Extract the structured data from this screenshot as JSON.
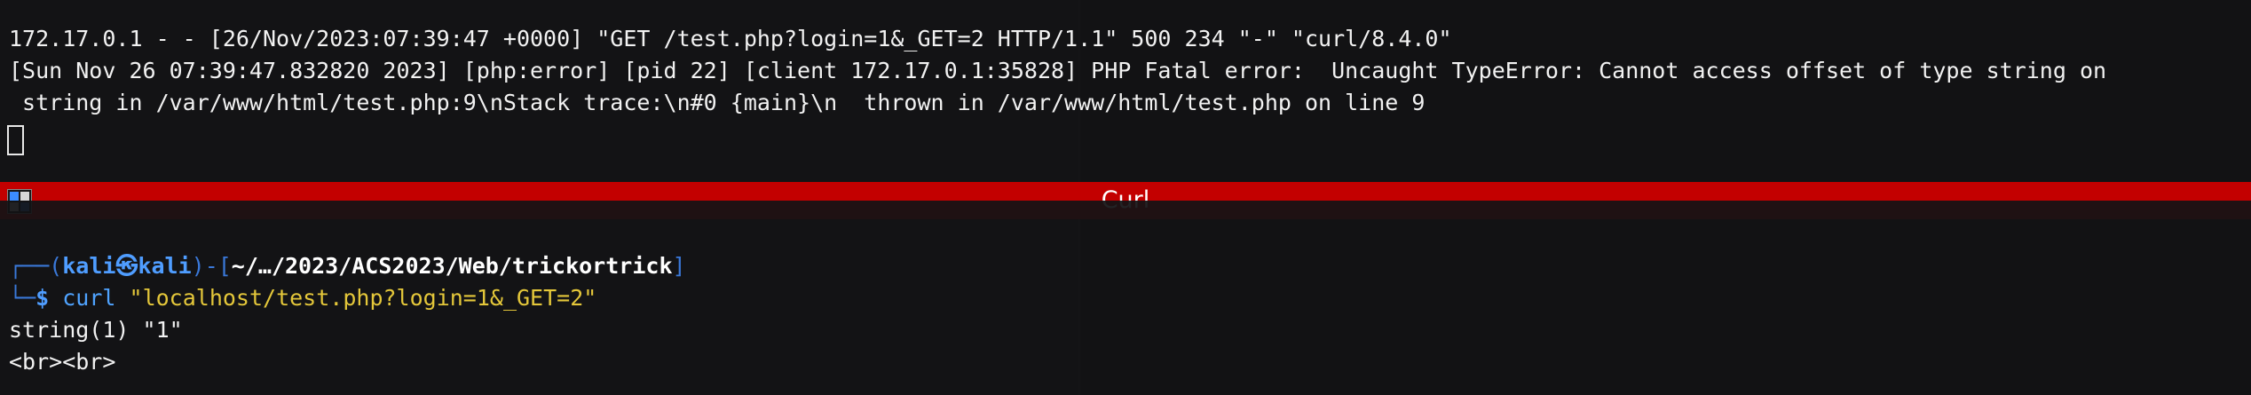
{
  "top_terminal": {
    "lines": [
      "172.17.0.1 - - [26/Nov/2023:07:39:47 +0000] \"GET /test.php?login=1&_GET=2 HTTP/1.1\" 500 234 \"-\" \"curl/8.4.0\"",
      "[Sun Nov 26 07:39:47.832820 2023] [php:error] [pid 22] [client 172.17.0.1:35828] PHP Fatal error:  Uncaught TypeError: Cannot access offset of type string on",
      " string in /var/www/html/test.php:9\\nStack trace:\\n#0 {main}\\n  thrown in /var/www/html/test.php on line 9"
    ]
  },
  "bottom_terminal": {
    "title": "Curl",
    "prompt": {
      "line1_prefix": "┌──(",
      "user": "kali㉿kali",
      "line1_mid": ")-[",
      "path": "~/…/2023/ACS2023/Web/trickortrick",
      "line1_suffix": "]",
      "line2_prefix": "└─",
      "symbol": "$",
      "command": "curl",
      "argument": "\"localhost/test.php?login=1&_GET=2\""
    },
    "output": [
      "string(1) \"1\"",
      "<br><br>"
    ]
  },
  "colors": {
    "titlebar": "#c30000",
    "prompt_blue": "#4f9dff",
    "argument_yellow": "#e4c73a",
    "background": "#141414"
  },
  "icons": {
    "app_icon": "terminal-app-icon"
  }
}
